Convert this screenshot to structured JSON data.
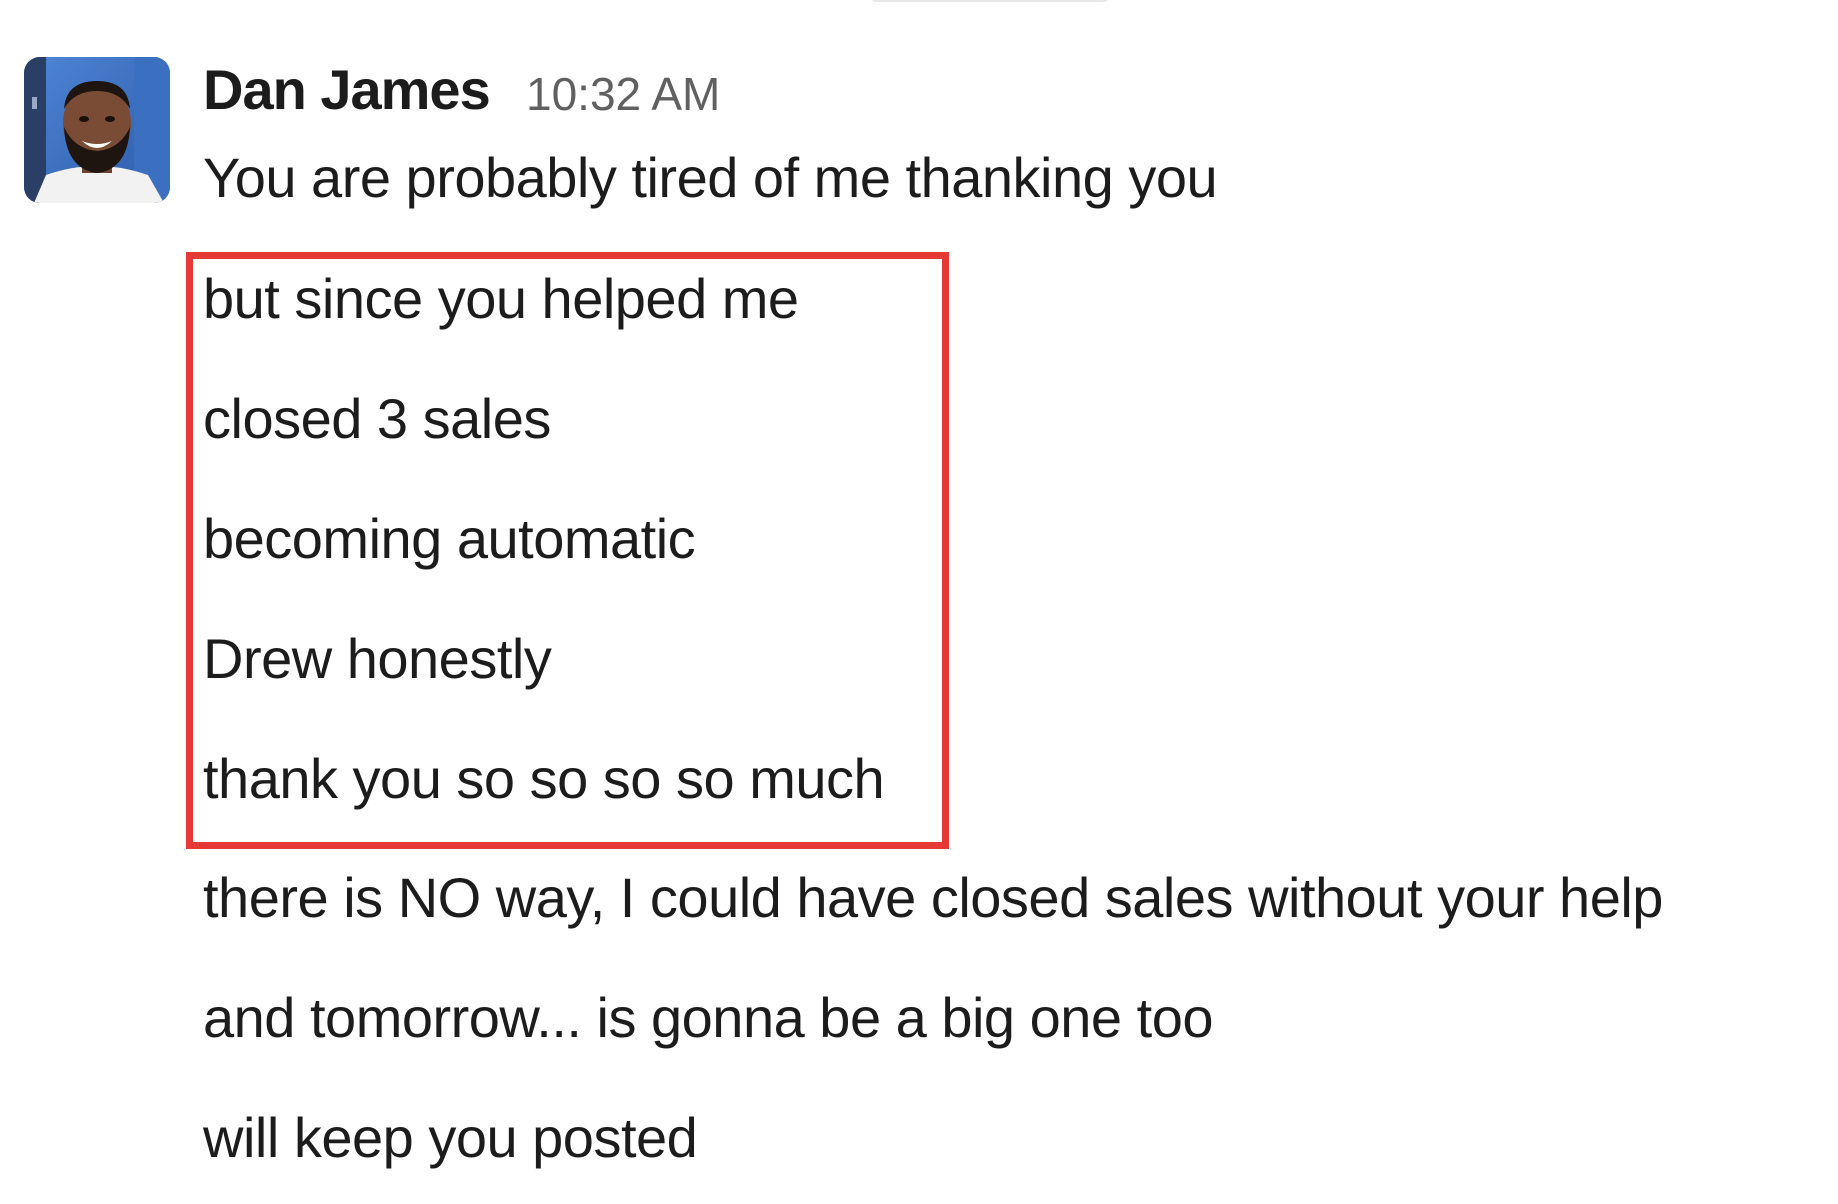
{
  "message": {
    "sender": "Dan James",
    "timestamp": "10:32 AM",
    "avatar_icon": "user-avatar-photo",
    "lines": [
      "You are probably tired of me thanking you",
      "but since you helped me",
      "closed 3 sales",
      "becoming automatic",
      "Drew honestly",
      "thank you so so so so much",
      "there is NO way, I could have closed sales without your help",
      "and tomorrow... is gonna be a big one too",
      "will keep you posted"
    ]
  },
  "colors": {
    "highlight_border": "#e53935",
    "text": "#1d1c1d",
    "timestamp": "#616061"
  }
}
